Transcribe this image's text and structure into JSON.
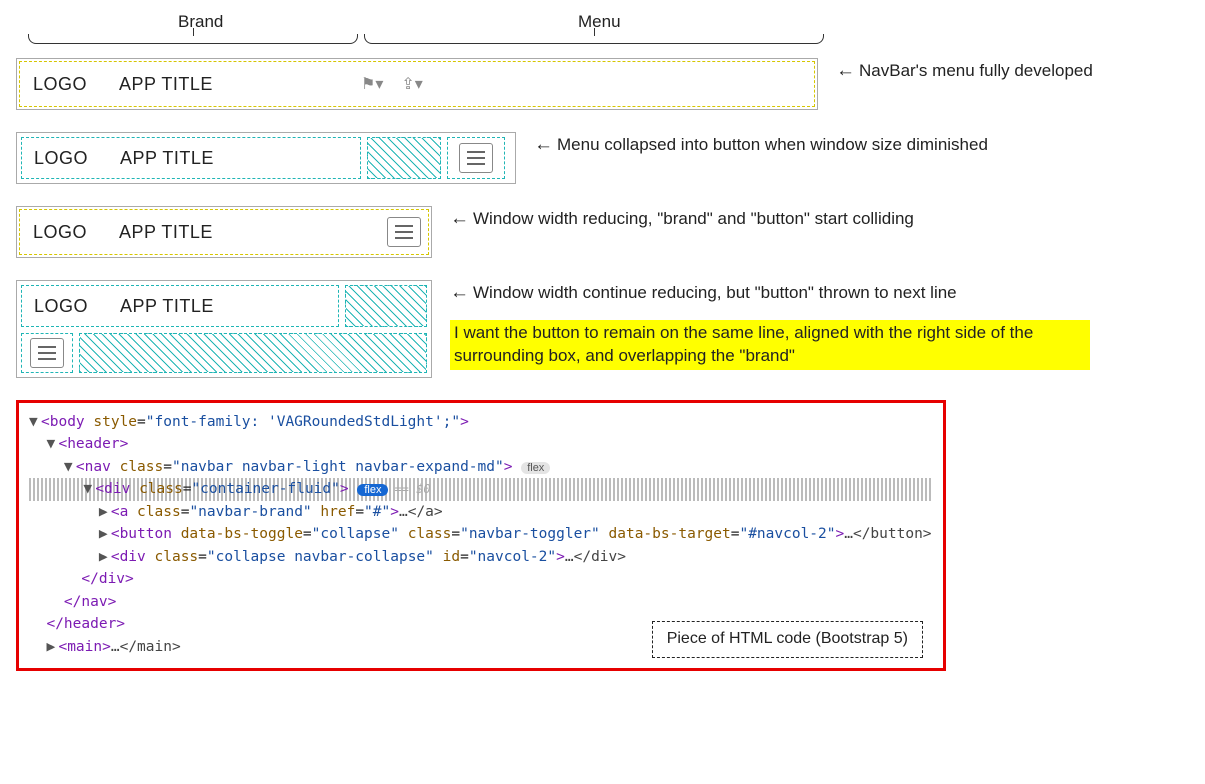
{
  "labels": {
    "brand": "Brand",
    "menu": "Menu"
  },
  "mock": {
    "logo": "LOGO",
    "title": "APP TITLE"
  },
  "captions": {
    "c1": "NavBar's menu fully developed",
    "c2": "Menu collapsed into button when window size diminished",
    "c3": "Window width reducing, \"brand\" and \"button\" start colliding",
    "c4": "Window width continue reducing, but \"button\" thrown to next line",
    "c4_hi": "I want the button to remain on the same line, aligned with the right side of the surrounding box, and overlapping the \"brand\""
  },
  "code": {
    "label": "Piece of HTML code (Bootstrap 5)",
    "l1_a": "body",
    "l1_attr": "style",
    "l1_val": "\"font-family: 'VAGRoundedStdLight';\"",
    "l2": "header",
    "l3_a": "nav",
    "l3_attr": "class",
    "l3_val": "\"navbar navbar-light navbar-expand-md\"",
    "l3_pill": "flex",
    "l4_a": "div",
    "l4_attr": "class",
    "l4_val": "\"container-fluid\"",
    "l4_pill": "flex",
    "l4_eq": "== $0",
    "l5_a": "a",
    "l5_attr1": "class",
    "l5_val1": "\"navbar-brand\"",
    "l5_attr2": "href",
    "l5_val2": "\"#\"",
    "l5_end": "…</a>",
    "l6_a": "button",
    "l6_attr1": "data-bs-toggle",
    "l6_val1": "\"collapse\"",
    "l6_attr2": "class",
    "l6_val2": "\"navbar-toggler\"",
    "l6_attr3": "data-bs-target",
    "l6_val3": "\"#navcol-2\"",
    "l6_end": "…</button>",
    "l7_a": "div",
    "l7_attr1": "class",
    "l7_val1": "\"collapse navbar-collapse\"",
    "l7_attr2": "id",
    "l7_val2": "\"navcol-2\"",
    "l7_end": "…</div>",
    "l8": "</div>",
    "l9": "</nav>",
    "l10": "</header>",
    "l11_a": "main",
    "l11_end": "…</main>"
  }
}
